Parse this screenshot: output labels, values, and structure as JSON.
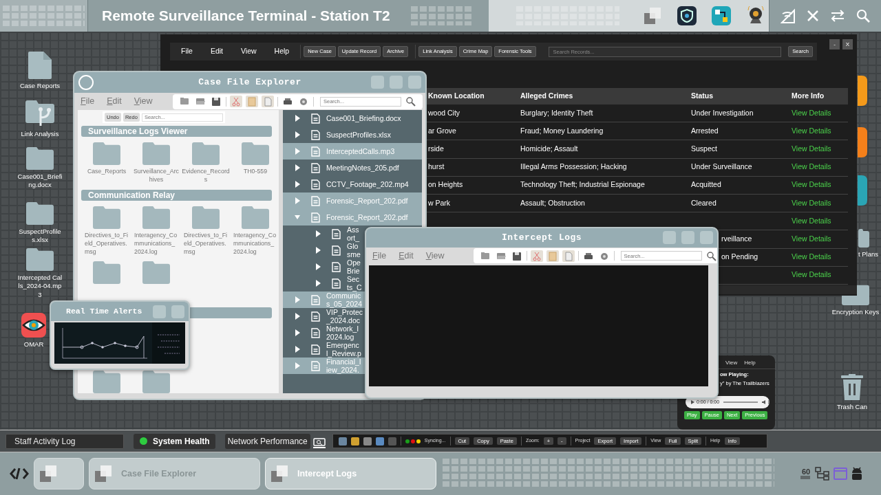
{
  "top_bar": {
    "title": "Remote Surveillance Terminal - Station T2"
  },
  "desktop_left": [
    {
      "label": "Case Reports",
      "kind": "file"
    },
    {
      "label": "Link Analysis",
      "kind": "branch"
    },
    {
      "label": "Case001_Briefing.docx",
      "kind": "folder"
    },
    {
      "label": "SuspectProfiles.xlsx",
      "kind": "folder"
    },
    {
      "label": "Intercepted Calls_2024-04.mp3",
      "kind": "folder"
    },
    {
      "label": "OMAR",
      "kind": "app"
    }
  ],
  "desktop_right": [
    {
      "label": "t Plans",
      "kind": "folder"
    },
    {
      "label": "Encryption Keys",
      "kind": "folder"
    },
    {
      "label": "Trash Can",
      "kind": "trash"
    }
  ],
  "records_window": {
    "menu": [
      "File",
      "Edit",
      "View",
      "Help"
    ],
    "toolbar_groups": [
      [
        "New Case",
        "Update Record",
        "Archive"
      ],
      [
        "Link Analysis",
        "Crime Map",
        "Forensic Tools"
      ]
    ],
    "search": {
      "placeholder": "Search Records...",
      "button": "Search"
    },
    "window_buttons": [
      "-",
      "X"
    ],
    "columns": [
      "Known Location",
      "Alleged Crimes",
      "Status",
      "More Info"
    ],
    "rows": [
      {
        "location": "wood City",
        "crimes": "Burglary; Identity Theft",
        "status": "Under Investigation",
        "link": "View Details"
      },
      {
        "location": "ar Grove",
        "crimes": "Fraud; Money Laundering",
        "status": "Arrested",
        "link": "View Details"
      },
      {
        "location": "rside",
        "crimes": "Homicide; Assault",
        "status": "Suspect",
        "link": "View Details"
      },
      {
        "location": "hurst",
        "crimes": "Illegal Arms Possession; Hacking",
        "status": "Under Surveillance",
        "link": "View Details"
      },
      {
        "location": "on Heights",
        "crimes": "Technology Theft; Industrial Espionage",
        "status": "Acquitted",
        "link": "View Details"
      },
      {
        "location": "w Park",
        "crimes": "Assault; Obstruction",
        "status": "Cleared",
        "link": "View Details"
      },
      {
        "link": "View Details"
      },
      {
        "status": "rveillance",
        "cut": true,
        "link": "View Details"
      },
      {
        "status": "on Pending",
        "cut": true,
        "link": "View Details"
      },
      {
        "link": "View Details"
      }
    ]
  },
  "case_file_explorer": {
    "title": "Case File Explorer",
    "menu": [
      "File",
      "Edit",
      "View"
    ],
    "search_placeholder": "Search...",
    "mini_toolbar": {
      "buttons": [
        "Undo",
        "Redo"
      ],
      "search_placeholder": "Search..."
    },
    "sections": [
      {
        "title": "Surveillance Logs Viewer",
        "folders": [
          {
            "kind": "folder",
            "label": "Case_Reports"
          },
          {
            "kind": "folder",
            "label": "Surveillance_Archives"
          },
          {
            "kind": "folder",
            "label": "Evidence_Records"
          },
          {
            "kind": "folder",
            "label": "TH0-559"
          }
        ]
      },
      {
        "title": "Communication Relay",
        "folders": [
          {
            "kind": "folder",
            "label": "Directives_to_Field_Operatives.msg"
          },
          {
            "kind": "folder",
            "label": "Interagency_Communications_2024.log"
          },
          {
            "kind": "folder",
            "label": "Directives_to_Field_Operatives.msg"
          },
          {
            "kind": "folder",
            "label": "Interagency_Communications_2024.log"
          },
          {
            "kind": "folder"
          },
          {
            "kind": "folder"
          }
        ]
      },
      {
        "folders": [
          {
            "kind": "folder"
          },
          {
            "kind": "folder"
          }
        ]
      }
    ],
    "tree": [
      {
        "lines": [
          "Case001_Briefing.docx"
        ],
        "highlighted": false,
        "expanded": false
      },
      {
        "lines": [
          "SuspectProfiles.xlsx"
        ],
        "highlighted": false,
        "expanded": false
      },
      {
        "lines": [
          "InterceptedCalls.mp3"
        ],
        "highlighted": true,
        "expanded": false
      },
      {
        "lines": [
          "MeetingNotes_205.pdf"
        ],
        "highlighted": false,
        "expanded": false
      },
      {
        "lines": [
          "CCTV_Footage_202.mp4"
        ],
        "highlighted": false,
        "expanded": false
      },
      {
        "lines": [
          "Forensic_Report_202.pdf"
        ],
        "highlighted": true,
        "expanded": false
      },
      {
        "lines": [
          "Forensic_Report_202.pdf"
        ],
        "highlighted": true,
        "expanded": true,
        "children": [
          {
            "lines": [
              "Ass",
              "ort_"
            ],
            "highlighted": false,
            "expanded": false
          },
          {
            "lines": [
              "Glo",
              "sme"
            ],
            "highlighted": false,
            "expanded": false
          },
          {
            "lines": [
              "Ope",
              "Brie"
            ],
            "highlighted": false,
            "expanded": false
          },
          {
            "lines": [
              "Sec",
              "ts_C"
            ],
            "highlighted": false,
            "expanded": false
          }
        ]
      },
      {
        "lines": [
          "Communic",
          "s_05_2024"
        ],
        "highlighted": true,
        "expanded": false
      },
      {
        "lines": [
          "VIP_Protec",
          "_2024.doc"
        ],
        "highlighted": false,
        "expanded": false
      },
      {
        "lines": [
          "Network_I",
          "2024.log"
        ],
        "highlighted": false,
        "expanded": false
      },
      {
        "lines": [
          "Emergenc",
          "l_Review.p"
        ],
        "highlighted": false,
        "expanded": false
      },
      {
        "lines": [
          "Financial_I",
          "iew_2024."
        ],
        "highlighted": true,
        "expanded": false
      }
    ]
  },
  "alerts_window": {
    "title": "Real Time Alerts"
  },
  "intercept_window": {
    "title": "Intercept Logs",
    "menu": [
      "File",
      "Edit",
      "View"
    ],
    "search_placeholder": "Search..."
  },
  "music_player": {
    "menu": [
      "View",
      "Help"
    ],
    "now_playing": "ow Playing:",
    "track": "y\" by The Trailblazers",
    "time": "0:00 / 0:00",
    "buttons": [
      "Play",
      "Pause",
      "Next",
      "Previous"
    ]
  },
  "status_bar": {
    "log_field": "Staff Activity Log",
    "health": {
      "label": "System Health",
      "color": "#2ecc40"
    },
    "network": "Network Performance",
    "sync": {
      "dots": [
        {
          "color": "#1a9e1a"
        },
        {
          "color": "#e01010"
        },
        {
          "color": "#f0d000"
        }
      ],
      "label": "Syncing..."
    },
    "groups": [
      {
        "buttons": [
          "Cut",
          "Copy",
          "Paste"
        ]
      },
      {
        "label": "Zoom:",
        "buttons": [
          "+",
          "-"
        ]
      },
      {
        "label": "Project",
        "buttons": [
          "Export",
          "Import"
        ]
      },
      {
        "label": "View",
        "buttons": [
          "Full",
          "Split"
        ]
      },
      {
        "label": "Help",
        "buttons": [
          "Info"
        ]
      }
    ]
  },
  "taskbar": {
    "tasks": [
      {
        "selected": false
      },
      {
        "label": "Case File Explorer",
        "selected": false
      },
      {
        "label": "Intercept Logs",
        "selected": true
      }
    ],
    "tray_text": "60"
  }
}
